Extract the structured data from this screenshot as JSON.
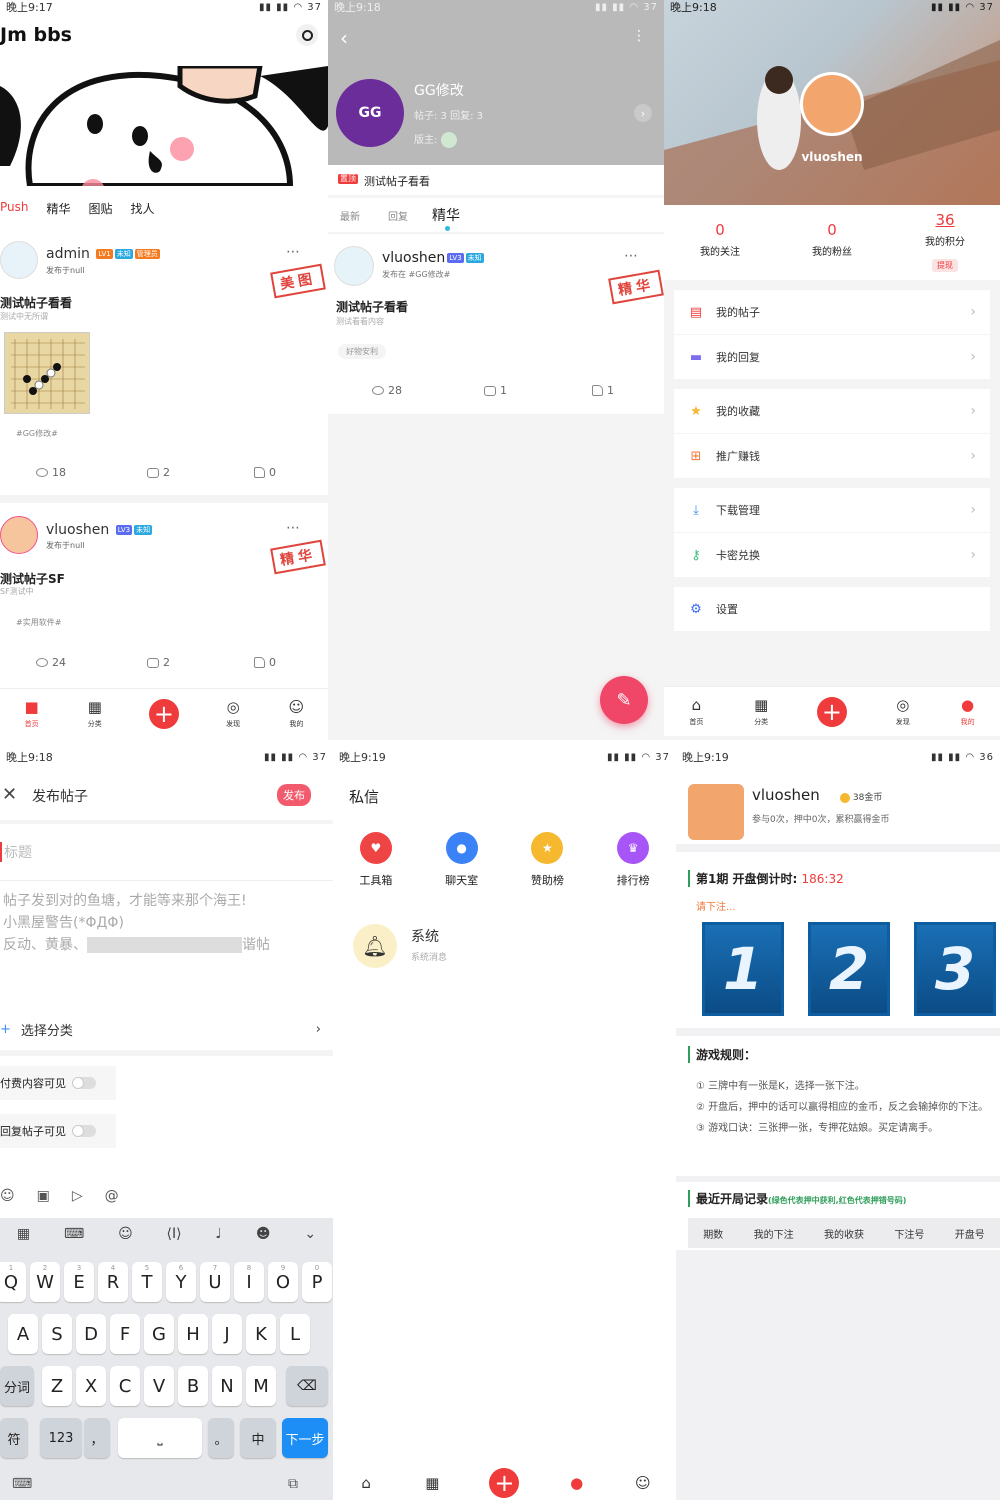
{
  "p1": {
    "status": {
      "time": "晚上9:17",
      "right": "37"
    },
    "app_title": "Jm bbs",
    "tabs": [
      "Push",
      "精华",
      "图贴",
      "找人"
    ],
    "posts": [
      {
        "user": "admin",
        "badges": [
          "LV1",
          "未知",
          "管理员"
        ],
        "meta": "发布于null",
        "title": "测试帖子看看",
        "desc": "测试中无所谓",
        "tag": "#GG修改#",
        "views": "18",
        "comments": "2",
        "likes": "0",
        "stamp": "美图"
      },
      {
        "user": "vluoshen",
        "badges": [
          "LV3",
          "未知"
        ],
        "meta": "发布于null",
        "title": "测试帖子SF",
        "desc": "SF测试中",
        "tag": "#实用软件#",
        "views": "24",
        "comments": "2",
        "likes": "0",
        "stamp": "精华"
      }
    ],
    "nav": [
      "首页",
      "分类",
      "",
      "发现",
      "我的"
    ]
  },
  "p2": {
    "status": {
      "time": "晚上9:18",
      "right": "37"
    },
    "group": {
      "name": "GG修改",
      "stats": "帖子: 3 回复: 3",
      "owner": "版主:",
      "avatar_text": "GG"
    },
    "pinned_badge": "置顶",
    "pinned_title": "测试帖子看看",
    "tabs": [
      "最新",
      "回复",
      "精华"
    ],
    "post": {
      "user": "vluoshen",
      "badges": [
        "LV3",
        "未知"
      ],
      "meta": "发布在 #GG修改#",
      "title": "测试帖子看看",
      "desc": "测试看看内容",
      "tag": "好物安利",
      "views": "28",
      "comments": "1",
      "likes": "1",
      "stamp": "精华"
    }
  },
  "p3": {
    "status": {
      "time": "晚上9:18",
      "right": "37"
    },
    "username": "vluoshen",
    "stats": [
      {
        "value": "0",
        "label": "我的关注"
      },
      {
        "value": "0",
        "label": "我的粉丝"
      },
      {
        "value": "36",
        "label": "我的积分"
      }
    ],
    "withdraw": "提现",
    "menu": [
      "我的帖子",
      "我的回复",
      "我的收藏",
      "推广赚钱",
      "下载管理",
      "卡密兑换",
      "设置"
    ],
    "nav": [
      "首页",
      "分类",
      "",
      "发现",
      "我的"
    ]
  },
  "p4": {
    "status": {
      "time": "晚上9:18",
      "right": "37"
    },
    "header_title": "发布帖子",
    "publish": "发布",
    "title_placeholder": "标题",
    "body_text_1": "帖子发到对的鱼塘，才能等来那个海王!",
    "body_text_2": "小黑屋警告(*ΦДΦ)",
    "body_text_3": "反动、黄暴、",
    "body_text_4": "谐帖",
    "category": "选择分类",
    "paid_toggle": "付费内容可见",
    "reply_toggle": "回复帖子可见",
    "row1": [
      "Q",
      "W",
      "E",
      "R",
      "T",
      "Y",
      "U",
      "I",
      "O",
      "P"
    ],
    "row1_sup": [
      "1",
      "2",
      "3",
      "4",
      "5",
      "6",
      "7",
      "8",
      "9",
      "0"
    ],
    "row2": [
      "A",
      "S",
      "D",
      "F",
      "G",
      "H",
      "J",
      "K",
      "L"
    ],
    "row3": [
      "Z",
      "X",
      "C",
      "V",
      "B",
      "N",
      "M"
    ],
    "fenci": "分词",
    "fu": "符",
    "num": "123",
    "comma": "，",
    "period": "。",
    "lang": "中",
    "next": "下一步"
  },
  "p5": {
    "status": {
      "time": "晚上9:19",
      "right": "37"
    },
    "title": "私信",
    "shortcuts": [
      {
        "label": "工具箱",
        "color": "#ef4444"
      },
      {
        "label": "聊天室",
        "color": "#3b82f6"
      },
      {
        "label": "赞助榜",
        "color": "#f5b82e"
      },
      {
        "label": "排行榜",
        "color": "#a855f7"
      }
    ],
    "system_title": "系统",
    "system_sub": "系统消息",
    "nav": [
      "首页",
      "分类",
      "",
      "发现",
      "我的"
    ]
  },
  "p6": {
    "status": {
      "time": "晚上9:19",
      "right": "36"
    },
    "username": "vluoshen",
    "coins": "38金币",
    "sub": "参与0次，押中0次，累积赢得金币",
    "period_label": "第1期 开盘倒计时:",
    "countdown": "186:32",
    "hint": "请下注...",
    "cards": [
      "1",
      "2",
      "3"
    ],
    "rules_title": "游戏规则：",
    "rules": [
      "① 三牌中有一张是K，选择一张下注。",
      "② 开盘后，押中的话可以赢得相应的金币，反之会输掉你的下注。",
      "③ 游戏口诀：三张押一张，专押花姑娘。买定请离手。"
    ],
    "records_title": "最近开局记录",
    "records_note": "(绿色代表押中获利,红色代表押错号码)",
    "table_headers": [
      "期数",
      "我的下注",
      "我的收获",
      "下注号",
      "开盘号"
    ]
  }
}
